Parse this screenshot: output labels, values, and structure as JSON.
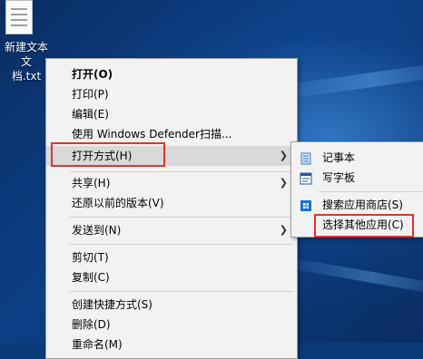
{
  "desktop_icon": {
    "label_line1": "新建文本文",
    "label_line2": "档.txt"
  },
  "context_menu": {
    "items": [
      {
        "label": "打开(O)"
      },
      {
        "label": "打印(P)"
      },
      {
        "label": "编辑(E)"
      },
      {
        "label": "使用 Windows Defender扫描..."
      },
      {
        "label": "打开方式(H)"
      },
      {
        "label": "共享(H)"
      },
      {
        "label": "还原以前的版本(V)"
      },
      {
        "label": "发送到(N)"
      },
      {
        "label": "剪切(T)"
      },
      {
        "label": "复制(C)"
      },
      {
        "label": "创建快捷方式(S)"
      },
      {
        "label": "删除(D)"
      },
      {
        "label": "重命名(M)"
      }
    ]
  },
  "submenu": {
    "items": [
      {
        "label": "记事本",
        "icon": "notepad-icon"
      },
      {
        "label": "写字板",
        "icon": "wordpad-icon"
      },
      {
        "label": "搜索应用商店(S)",
        "icon": "store-icon"
      },
      {
        "label": "选择其他应用(C)",
        "icon": ""
      }
    ]
  },
  "colors": {
    "highlight_border": "#e0332f",
    "hover_bg": "#d9d9d9",
    "menu_bg": "#f2f2f2"
  }
}
